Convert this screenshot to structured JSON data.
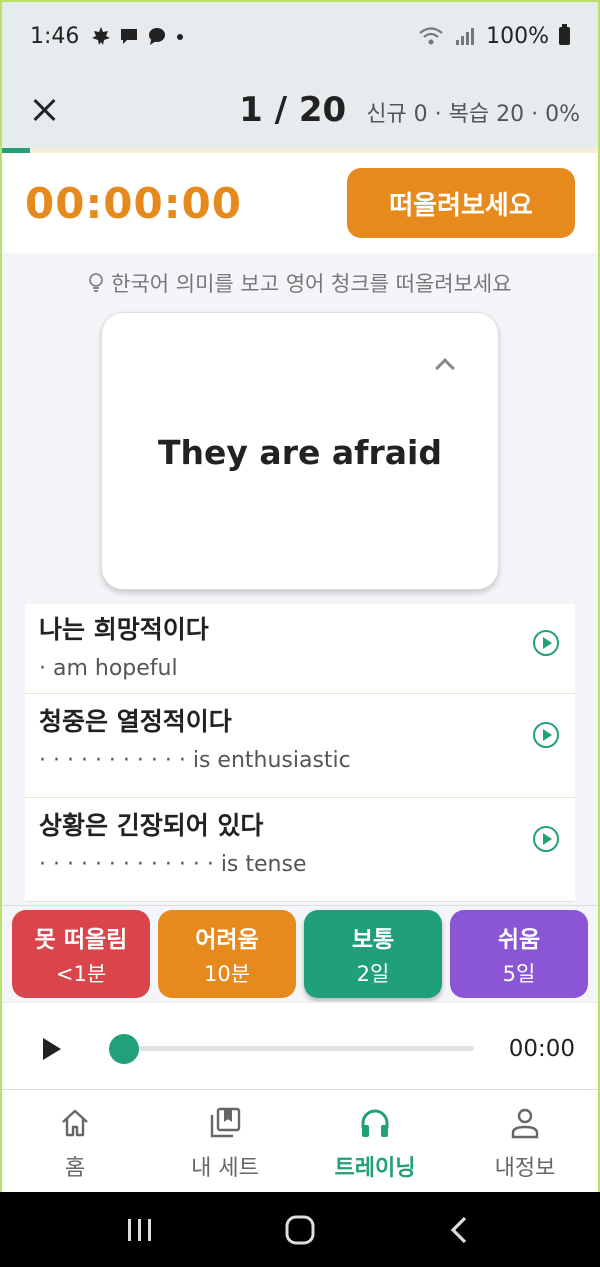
{
  "status": {
    "time": "1:46",
    "battery": "100%"
  },
  "header": {
    "count": "1 / 20",
    "stats": "신규 0 · 복습 20 · 0%",
    "progress_fraction": 0.05
  },
  "timer": {
    "value": "00:00:00",
    "button": "떠올려보세요"
  },
  "hint": "한국어 의미를 보고 영어 청크를 떠올려보세요",
  "card": {
    "text": "They are afraid"
  },
  "list": [
    {
      "ko": "나는 희망적이다",
      "en": "· am hopeful"
    },
    {
      "ko": "청중은 열정적이다",
      "en": "· · ·  · · · · · · · ·  is enthusiastic"
    },
    {
      "ko": "상황은 긴장되어 있다",
      "en": "· · ·  · · · · · · · · · ·  is tense"
    }
  ],
  "ratings": [
    {
      "label": "못 떠올림",
      "value": "<1분",
      "color": "#d9454a"
    },
    {
      "label": "어려움",
      "value": "10분",
      "color": "#e68a1e"
    },
    {
      "label": "보통",
      "value": "2일",
      "color": "#20a07a"
    },
    {
      "label": "쉬움",
      "value": "5일",
      "color": "#8b56d6"
    }
  ],
  "player": {
    "time": "00:00",
    "position_fraction": 0
  },
  "nav": [
    {
      "label": "홈",
      "icon": "home-icon"
    },
    {
      "label": "내 세트",
      "icon": "library-icon"
    },
    {
      "label": "트레이닝",
      "icon": "headphones-icon",
      "active": true
    },
    {
      "label": "내정보",
      "icon": "person-icon"
    }
  ],
  "colors": {
    "accent": "#22a07a",
    "orange": "#e68a1e"
  }
}
